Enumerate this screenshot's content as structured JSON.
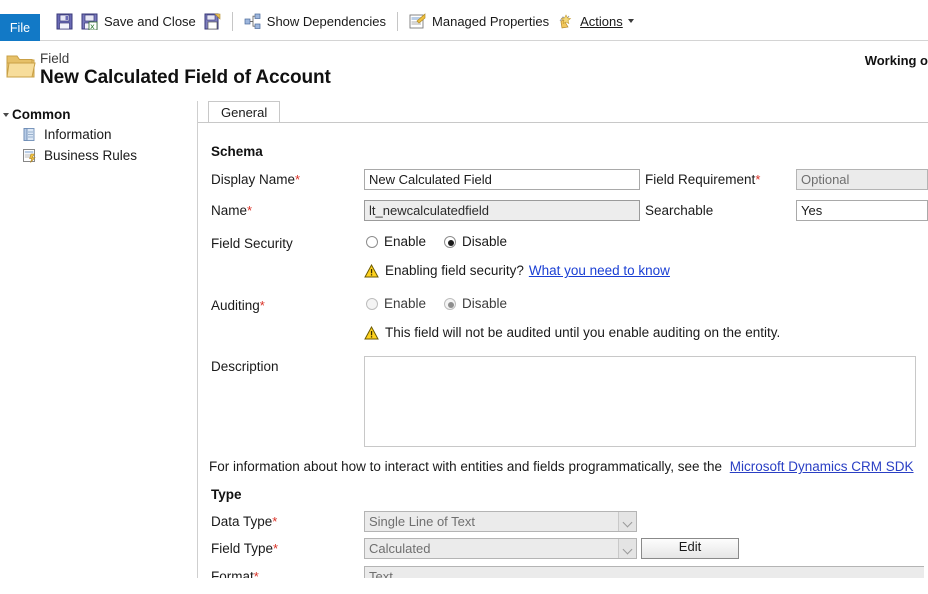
{
  "ribbon": {
    "file_label": "File",
    "items": [
      {
        "name": "save",
        "icon": "save-icon",
        "label": ""
      },
      {
        "name": "save-and-close",
        "icon": "save-and-close-icon",
        "label": "Save and Close"
      },
      {
        "name": "save-as-solution",
        "icon": "save-as-icon",
        "label": ""
      },
      {
        "name": "show-dependencies",
        "icon": "dependencies-icon",
        "label": "Show Dependencies"
      },
      {
        "name": "managed-properties",
        "icon": "managed-properties-icon",
        "label": "Managed Properties"
      },
      {
        "name": "actions",
        "icon": "actions-icon",
        "label": "Actions"
      }
    ]
  },
  "header": {
    "subtitle": "Field",
    "title": "New Calculated Field of Account",
    "working_on": "Working o"
  },
  "sidebar": {
    "group_label": "Common",
    "items": [
      {
        "label": "Information",
        "icon": "information-icon"
      },
      {
        "label": "Business Rules",
        "icon": "business-rules-icon"
      }
    ]
  },
  "tabs": [
    {
      "label": "General",
      "active": true
    }
  ],
  "form": {
    "schema_title": "Schema",
    "display_name": {
      "label": "Display Name",
      "required": "*",
      "value": "New Calculated Field"
    },
    "name": {
      "label": "Name",
      "required": "*",
      "value": "lt_newcalculatedfield"
    },
    "field_requirement": {
      "label": "Field Requirement",
      "required": "*",
      "value": "Optional"
    },
    "searchable": {
      "label": "Searchable",
      "value": "Yes"
    },
    "field_security": {
      "label": "Field Security",
      "enable_label": "Enable",
      "disable_label": "Disable",
      "selected": "Disable",
      "warning_text": "Enabling field security?",
      "warning_link": "What you need to know"
    },
    "auditing": {
      "label": "Auditing",
      "required": "*",
      "enable_label": "Enable",
      "disable_label": "Disable",
      "selected": "Disable",
      "warning_text": "This field will not be audited until you enable auditing on the entity."
    },
    "description": {
      "label": "Description",
      "value": "",
      "placeholder": ""
    },
    "info_line": {
      "text": "For information about how to interact with entities and fields programmatically, see the",
      "link": "Microsoft Dynamics CRM SDK"
    },
    "type_title": "Type",
    "data_type": {
      "label": "Data Type",
      "required": "*",
      "value": "Single Line of Text"
    },
    "field_type": {
      "label": "Field Type",
      "required": "*",
      "value": "Calculated",
      "edit_button": "Edit"
    },
    "format": {
      "label": "Format",
      "required": "*",
      "value": "Text"
    }
  },
  "colors": {
    "file_blue": "#1279c6",
    "link_blue": "#1a3fd4",
    "required_red": "#d93025",
    "warning_yellow": "#ffd11a"
  }
}
